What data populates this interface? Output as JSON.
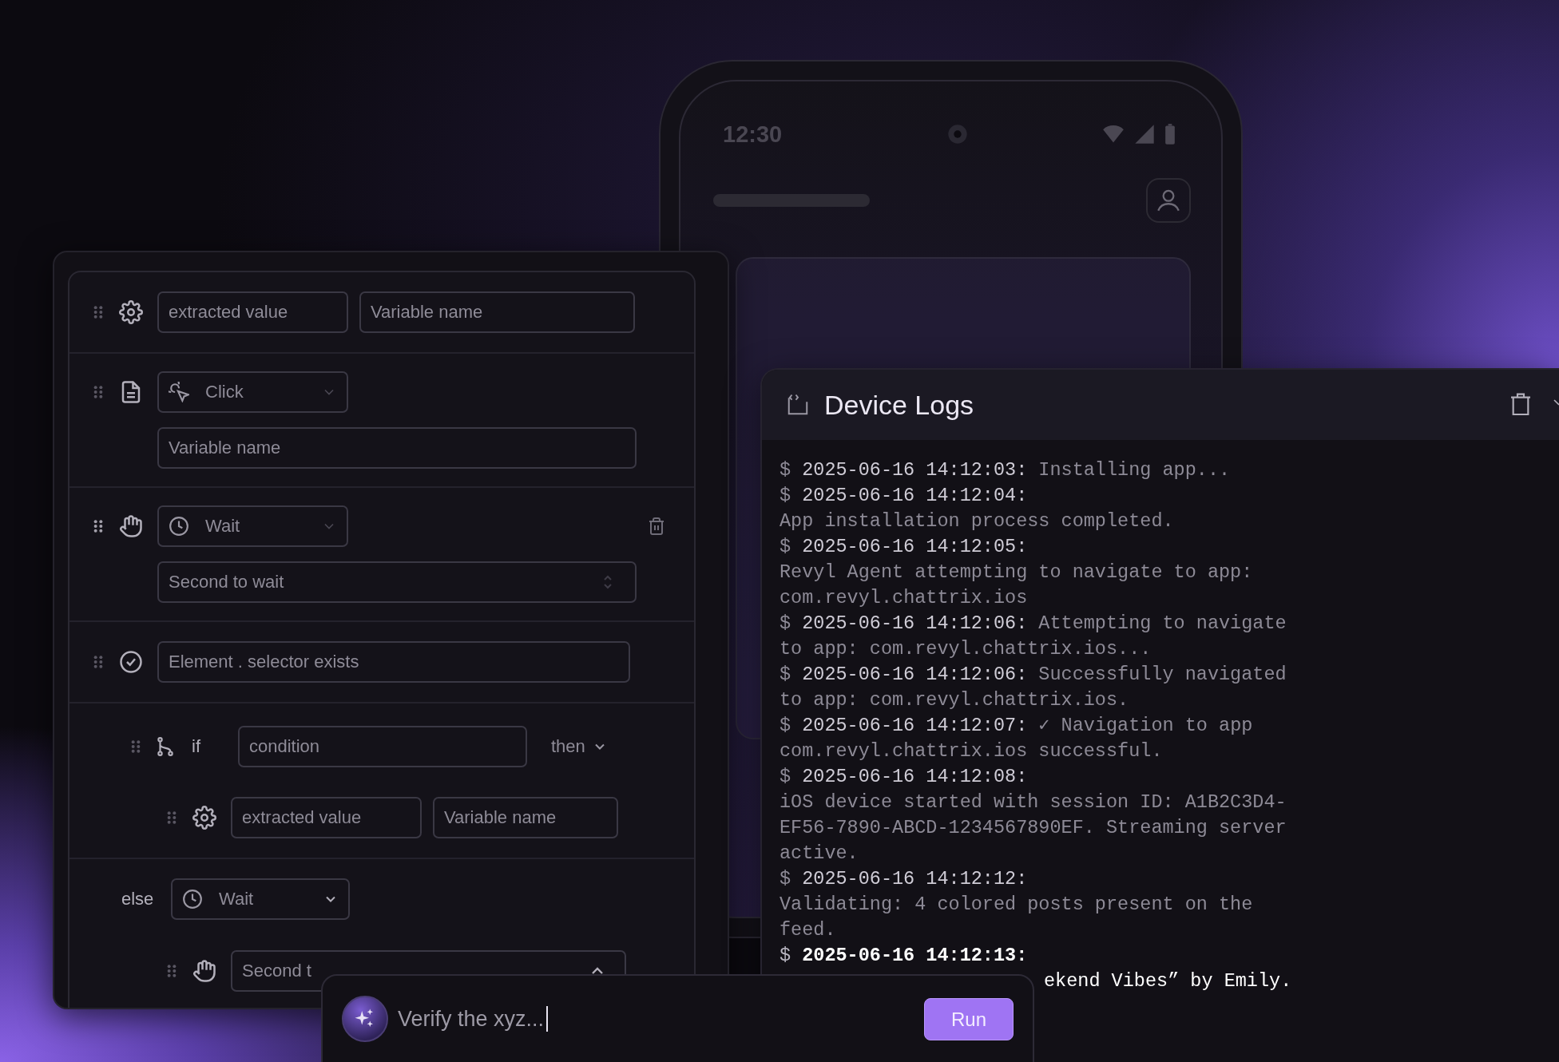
{
  "phone": {
    "time": "12:30"
  },
  "builder": {
    "steps": [
      {
        "kind": "extract",
        "fields": [
          {
            "placeholder": "extracted value"
          },
          {
            "placeholder": "Variable name"
          }
        ]
      },
      {
        "kind": "click",
        "select": "Click",
        "field": {
          "placeholder": "Variable name"
        }
      },
      {
        "kind": "wait",
        "select": "Wait",
        "field": {
          "placeholder": "Second to wait"
        }
      },
      {
        "kind": "assert",
        "field": {
          "placeholder": "Element . selector exists"
        }
      },
      {
        "kind": "if",
        "label": "if",
        "condition": {
          "placeholder": "condition"
        },
        "branch": "then",
        "children": [
          {
            "kind": "extract",
            "fields": [
              {
                "placeholder": "extracted value"
              },
              {
                "placeholder": "Variable name"
              }
            ]
          }
        ]
      },
      {
        "kind": "else",
        "label": "else",
        "select": "Wait",
        "children": [
          {
            "kind": "wait",
            "field": {
              "placeholder": "Second t"
            }
          }
        ]
      }
    ]
  },
  "logs": {
    "title": "Device Logs",
    "lines": [
      {
        "prompt": "$",
        "stamp": "2025-06-16 14:12:03:",
        "text": "Installing app...",
        "current": false
      },
      {
        "prompt": "$",
        "stamp": "2025-06-16 14:12:04:",
        "current": false
      },
      {
        "text": "App installation process completed.",
        "current": false
      },
      {
        "prompt": "$",
        "stamp": "2025-06-16 14:12:05:",
        "current": false
      },
      {
        "text": "Revyl Agent attempting to navigate to app:",
        "current": false
      },
      {
        "text": "com.revyl.chattrix.ios",
        "current": false
      },
      {
        "prompt": "$",
        "stamp": "2025-06-16 14:12:06:",
        "text": "Attempting to navigate",
        "current": false
      },
      {
        "text": "to app: com.revyl.chattrix.ios...",
        "current": false
      },
      {
        "prompt": "$",
        "stamp": "2025-06-16 14:12:06:",
        "text": "Successfully navigated",
        "current": false
      },
      {
        "text": "to app: com.revyl.chattrix.ios.",
        "current": false
      },
      {
        "prompt": "$",
        "stamp": "2025-06-16 14:12:07:",
        "text": "✓ Navigation to app",
        "current": false
      },
      {
        "text": "com.revyl.chattrix.ios successful.",
        "current": false
      },
      {
        "prompt": "$",
        "stamp": "2025-06-16 14:12:08:",
        "current": false
      },
      {
        "text": "iOS device started with session ID: A1B2C3D4-",
        "current": false
      },
      {
        "text": "EF56-7890-ABCD-1234567890EF. Streaming server",
        "current": false
      },
      {
        "text": "active.",
        "current": false
      },
      {
        "prompt": "$",
        "stamp": "2025-06-16 14:12:12:",
        "current": false
      },
      {
        "text": "Validating: 4 colored posts present on the",
        "current": false
      },
      {
        "text": "feed.",
        "current": false
      },
      {
        "prompt": "$",
        "stamp": "2025-06-16 14:12:13:",
        "current": true
      }
    ],
    "tail": "ekend Vibes” by Emily."
  },
  "prompt": {
    "value": "Verify the xyz...",
    "button": "Run"
  }
}
